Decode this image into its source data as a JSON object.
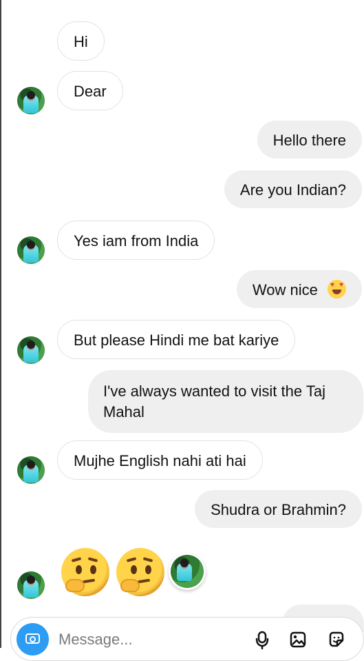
{
  "messages": [
    {
      "id": "hi",
      "direction": "incoming",
      "text": "Hi"
    },
    {
      "id": "dear",
      "direction": "incoming",
      "text": "Dear"
    },
    {
      "id": "hello",
      "direction": "outgoing",
      "text": "Hello there"
    },
    {
      "id": "indian",
      "direction": "outgoing",
      "text": "Are you Indian?"
    },
    {
      "id": "india",
      "direction": "incoming",
      "text": "Yes iam from India"
    },
    {
      "id": "wow",
      "direction": "outgoing",
      "text": "Wow nice"
    },
    {
      "id": "hindi",
      "direction": "incoming",
      "text": "But please Hindi me bat kariye"
    },
    {
      "id": "taj",
      "direction": "outgoing",
      "text": "I've always wanted to visit the Taj Mahal"
    },
    {
      "id": "english",
      "direction": "incoming",
      "text": "Mujhe English nahi ati hai"
    },
    {
      "id": "caste",
      "direction": "outgoing",
      "text": "Shudra or Brahmin?"
    }
  ],
  "emoji": {
    "heart_eyes": "heart-eyes-emoji",
    "thinking": "thinking-face-emoji"
  },
  "composer": {
    "placeholder": "Message..."
  },
  "colors": {
    "incoming_bubble": "#ffffff",
    "outgoing_bubble": "#efefef",
    "camera_blue": "#2d9cf4"
  }
}
